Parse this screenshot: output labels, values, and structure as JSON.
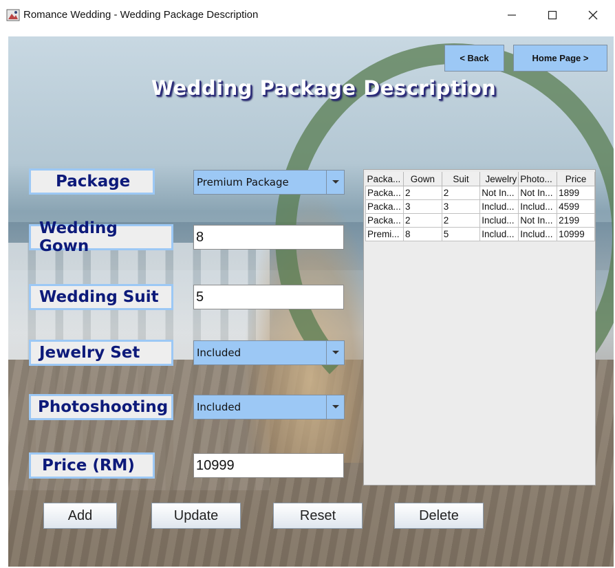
{
  "window": {
    "title": "Romance Wedding - Wedding Package Description"
  },
  "heading": "Wedding Package Description",
  "nav": {
    "back": "< Back",
    "home": "Home Page >"
  },
  "form": {
    "package_label": "Package",
    "package_value": "Premium Package",
    "gown_label": "Wedding Gown",
    "gown_value": "8",
    "suit_label": "Wedding Suit",
    "suit_value": "5",
    "jewelry_label": "Jewelry Set",
    "jewelry_value": "Included",
    "photo_label": "Photoshooting",
    "photo_value": "Included",
    "price_label": "Price (RM)",
    "price_value": "10999"
  },
  "table": {
    "headers": [
      "Packa...",
      "Gown",
      "Suit",
      "Jewelry",
      "Photo...",
      "Price"
    ],
    "rows": [
      [
        "Packa...",
        "2",
        "2",
        "Not In...",
        "Not In...",
        "1899"
      ],
      [
        "Packa...",
        "3",
        "3",
        "Includ...",
        "Includ...",
        "4599"
      ],
      [
        "Packa...",
        "2",
        "2",
        "Includ...",
        "Not In...",
        "2199"
      ],
      [
        "Premi...",
        "8",
        "5",
        "Includ...",
        "Includ...",
        "10999"
      ]
    ]
  },
  "buttons": {
    "add": "Add",
    "update": "Update",
    "reset": "Reset",
    "delete": "Delete"
  },
  "colors": {
    "accent": "#9cc8f5",
    "label_text": "#0d1a7a",
    "label_bg": "#eeeeee"
  },
  "icons": {
    "app": "wedding-app-icon",
    "minimize": "minimize-icon",
    "maximize": "maximize-icon",
    "close": "close-icon",
    "dropdown": "chevron-down-icon"
  }
}
